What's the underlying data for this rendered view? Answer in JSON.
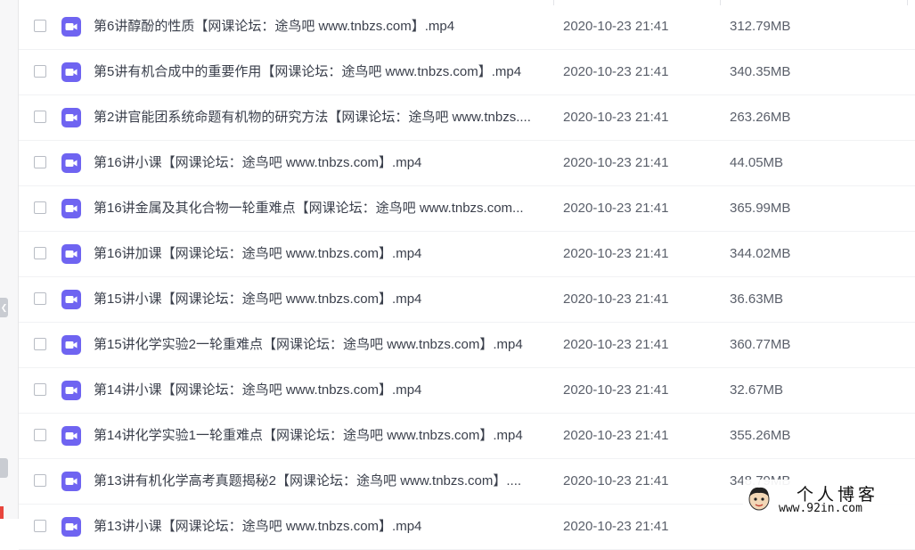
{
  "colors": {
    "accent": "#6f64f1",
    "text": "#3a3f4b",
    "muted": "#5a5f6a"
  },
  "file_list": {
    "icon": "video-file-icon",
    "rows": [
      {
        "name": "第6讲醇酚的性质【网课论坛：途鸟吧 www.tnbzs.com】.mp4",
        "date": "2020-10-23 21:41",
        "size": "312.79MB"
      },
      {
        "name": "第5讲有机合成中的重要作用【网课论坛：途鸟吧 www.tnbzs.com】.mp4",
        "date": "2020-10-23 21:41",
        "size": "340.35MB"
      },
      {
        "name": "第2讲官能团系统命题有机物的研究方法【网课论坛：途鸟吧 www.tnbzs....",
        "date": "2020-10-23 21:41",
        "size": "263.26MB"
      },
      {
        "name": "第16讲小课【网课论坛：途鸟吧 www.tnbzs.com】.mp4",
        "date": "2020-10-23 21:41",
        "size": "44.05MB"
      },
      {
        "name": "第16讲金属及其化合物一轮重难点【网课论坛：途鸟吧 www.tnbzs.com...",
        "date": "2020-10-23 21:41",
        "size": "365.99MB"
      },
      {
        "name": "第16讲加课【网课论坛：途鸟吧 www.tnbzs.com】.mp4",
        "date": "2020-10-23 21:41",
        "size": "344.02MB"
      },
      {
        "name": "第15讲小课【网课论坛：途鸟吧 www.tnbzs.com】.mp4",
        "date": "2020-10-23 21:41",
        "size": "36.63MB"
      },
      {
        "name": "第15讲化学实验2一轮重难点【网课论坛：途鸟吧 www.tnbzs.com】.mp4",
        "date": "2020-10-23 21:41",
        "size": "360.77MB"
      },
      {
        "name": "第14讲小课【网课论坛：途鸟吧 www.tnbzs.com】.mp4",
        "date": "2020-10-23 21:41",
        "size": "32.67MB"
      },
      {
        "name": "第14讲化学实验1一轮重难点【网课论坛：途鸟吧 www.tnbzs.com】.mp4",
        "date": "2020-10-23 21:41",
        "size": "355.26MB"
      },
      {
        "name": "第13讲有机化学高考真题揭秘2【网课论坛：途鸟吧 www.tnbzs.com】....",
        "date": "2020-10-23 21:41",
        "size": "348.79MB"
      },
      {
        "name": "第13讲小课【网课论坛：途鸟吧 www.tnbzs.com】.mp4",
        "date": "2020-10-23 21:41",
        "size": ""
      }
    ]
  },
  "watermark": {
    "title": "个人博客",
    "url": "www.92in.com"
  }
}
